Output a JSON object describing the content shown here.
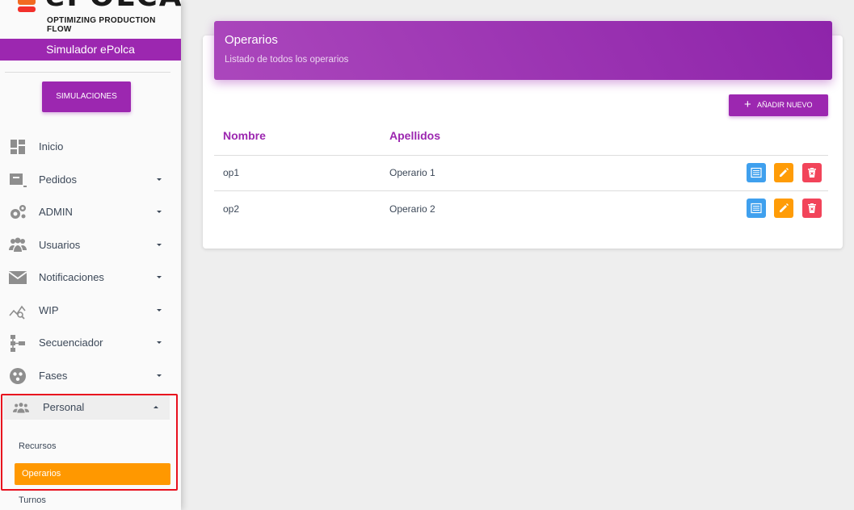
{
  "brand": {
    "logo_text": "ePOLCA",
    "logo_subtitle": "OPTIMIZING PRODUCTION FLOW",
    "app_title": "Simulador ePolca",
    "simulations_button": "SIMULACIONES"
  },
  "sidebar": {
    "items": [
      {
        "label": "Inicio",
        "icon": "dashboard-icon"
      },
      {
        "label": "Pedidos",
        "icon": "orders-icon"
      },
      {
        "label": "ADMIN",
        "icon": "gears-icon"
      },
      {
        "label": "Usuarios",
        "icon": "users-icon"
      },
      {
        "label": "Notificaciones",
        "icon": "mail-icon"
      },
      {
        "label": "WIP",
        "icon": "chart-search-icon"
      },
      {
        "label": "Secuenciador",
        "icon": "sequencer-icon"
      },
      {
        "label": "Fases",
        "icon": "phases-icon"
      }
    ],
    "personal": {
      "label": "Personal",
      "icon": "group-icon",
      "subitems": [
        "Recursos",
        "Operarios",
        "Turnos"
      ],
      "active": "Operarios"
    }
  },
  "main": {
    "card_title": "Operarios",
    "card_subtitle": "Listado de todos los operarios",
    "add_button": "AÑADIR NUEVO",
    "columns": [
      "Nombre",
      "Apellidos"
    ],
    "rows": [
      {
        "nombre": "op1",
        "apellidos": "Operario 1"
      },
      {
        "nombre": "op2",
        "apellidos": "Operario 2"
      }
    ]
  },
  "colors": {
    "primary": "#9c27b0",
    "active": "#ff9800",
    "view_action": "#3fa0ee",
    "edit_action": "#ff9c07",
    "delete_action": "#f2445a",
    "highlight": "#e8101e"
  }
}
